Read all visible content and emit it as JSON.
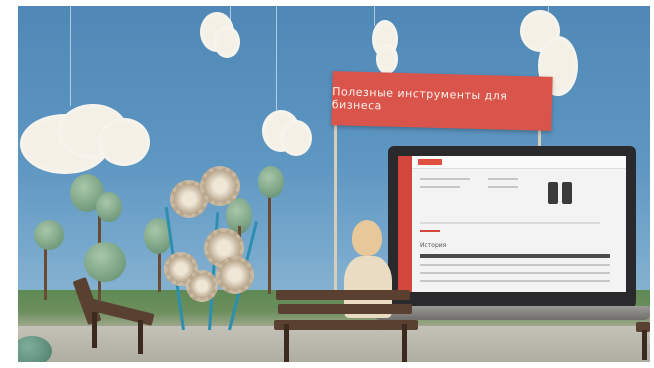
{
  "banner": {
    "text": "Полезные инструменты для бизнеса"
  },
  "laptop_screen": {
    "section_heading": "История"
  },
  "colors": {
    "banner": "#d9544a",
    "sky": "#5f97c3",
    "brand_red": "#d2473b"
  }
}
